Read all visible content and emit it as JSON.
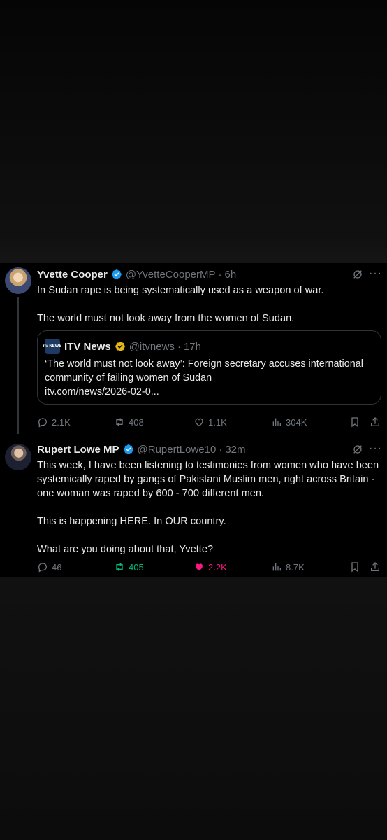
{
  "tweets": [
    {
      "name": "Yvette Cooper",
      "handle": "@YvetteCooperMP",
      "time": "6h",
      "body": "In Sudan rape is being systematically used as a weapon of war.\n\nThe world must not look away from the women of Sudan.",
      "quote": {
        "logo_text": "itv NEWS",
        "name": "ITV News",
        "handle": "@itvnews",
        "time": "17h",
        "body": "‘The world must not look away’: Foreign secretary accuses international community of failing women of Sudan\nitv.com/news/2026-02-0..."
      },
      "actions": {
        "replies": "2.1K",
        "reposts": "408",
        "likes": "1.1K",
        "views": "304K"
      }
    },
    {
      "name": "Rupert Lowe MP",
      "handle": "@RupertLowe10",
      "time": "32m",
      "body": "This week, I have been listening to testimonies from women who have been systemically raped by gangs of Pakistani Muslim men, right across Britain - one woman was raped by 600 - 700 different men.\n\nThis is happening HERE. In OUR country.\n\nWhat are you doing about that, Yvette?",
      "actions": {
        "replies": "46",
        "reposts": "405",
        "likes": "2.2K",
        "views": "8.7K"
      }
    }
  ],
  "dot_separator": "·",
  "more_glyph": "···",
  "colors": {
    "verified_blue": "#1d9bf0",
    "verified_gold": "#e2b719",
    "repost_active": "#00ba7c",
    "like_active": "#f91880",
    "muted": "#71767b"
  },
  "icons": [
    "verified-badge-icon",
    "grok-icon",
    "more-icon",
    "reply-icon",
    "repost-icon",
    "like-icon",
    "views-icon",
    "bookmark-icon",
    "share-icon"
  ]
}
